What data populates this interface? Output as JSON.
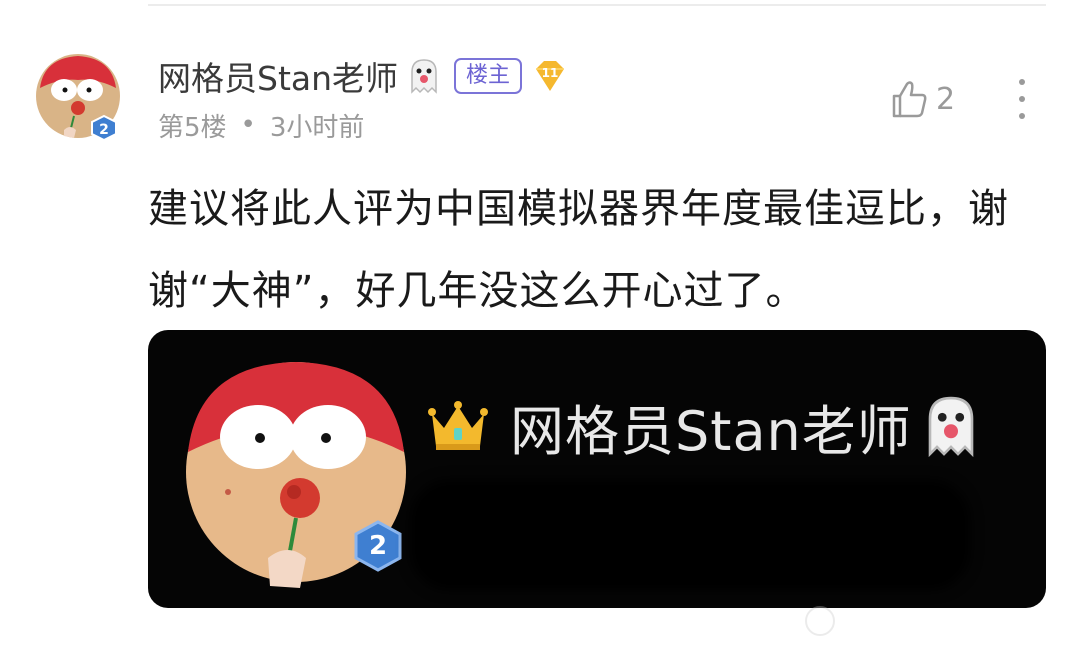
{
  "post": {
    "username": "网格员Stan老师",
    "op_badge": "楼主",
    "level": "11",
    "avatar_level": "2",
    "floor": "第5楼",
    "separator": "•",
    "time_ago": "3小时前",
    "like_count": "2",
    "comment_line1": "建议将此人评为中国模拟器界年度最佳逗比，谢",
    "comment_line2": "谢“大神”，好几年没这么开心过了。"
  },
  "image_card": {
    "name": "网格员Stan老师",
    "avatar_level": "2"
  },
  "colors": {
    "badge_purple": "#6c63d3",
    "level_gold": "#f5b82e",
    "meta_gray": "#9a9a9a",
    "card_bg": "#050505"
  },
  "icons": [
    "ghost-icon",
    "level-diamond-icon",
    "thumbs-up-icon",
    "more-vertical-icon",
    "crown-icon"
  ]
}
